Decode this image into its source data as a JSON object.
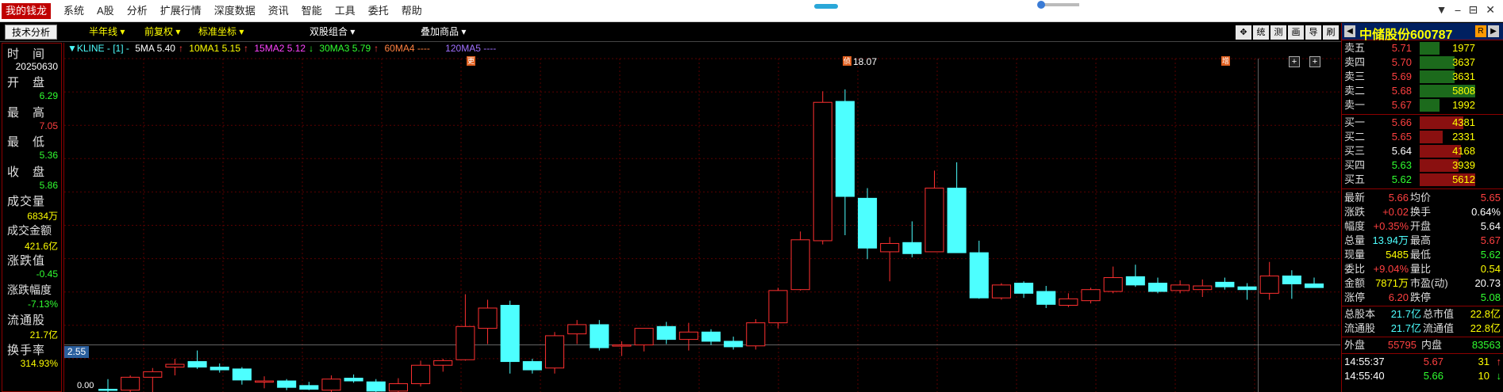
{
  "app": {
    "logo": "我的钱龙"
  },
  "menu": [
    "系统",
    "A股",
    "分析",
    "扩展行情",
    "深度数据",
    "资讯",
    "智能",
    "工具",
    "委托",
    "帮助"
  ],
  "window_buttons": [
    "▼",
    "⎯",
    "⊟",
    "✕"
  ],
  "toolbar": {
    "tab": "技术分析",
    "period": "半年线 ▾",
    "adjust": "前复权 ▾",
    "coord": "标准坐标 ▾",
    "dual": "双股组合 ▾",
    "overlay": "叠加商品 ▾",
    "icons": [
      "✥",
      "统",
      "测",
      "画",
      "导",
      "刷"
    ]
  },
  "left_panel": {
    "time_label": "时　间",
    "date": "20250630",
    "open_label": "开　盘",
    "open": "6.29",
    "high_label": "最　高",
    "high": "7.05",
    "low_label": "最　低",
    "low": "5.36",
    "close_label": "收　盘",
    "close": "5.86",
    "vol_label": "成交量",
    "vol": "6834万",
    "amt_label": "成交金额",
    "amt": "421.6亿",
    "chg_label": "涨跌值",
    "chg": "-0.45",
    "chgpct_label": "涨跌幅度",
    "chgpct": "-7.13%",
    "float_label": "流通股",
    "float": "21.7亿",
    "turnover_label": "换手率",
    "turnover": "314.93%"
  },
  "legend": {
    "kline": "▼KLINE - [1] -",
    "ma5": "5MA 5.40",
    "ma10": "10MA1 5.15",
    "ma15": "15MA2 5.12",
    "ma30": "30MA3 5.79",
    "ma60": "60MA4 ----",
    "ma120": "120MA5 ----"
  },
  "chart_data": {
    "type": "candlestick",
    "title": "",
    "ylabel": "",
    "ylim": [
      0.0,
      18.07
    ],
    "max_label": "18.07",
    "cursor_price": "2.55",
    "bottom_label": "0.00",
    "up_color": "#ff3030",
    "down_color": "#4dffff",
    "flags": [
      "更",
      "侦",
      "增"
    ],
    "candles": [
      {
        "o": 0.15,
        "h": 0.7,
        "l": 0.0,
        "c": 0.1
      },
      {
        "o": 0.1,
        "h": 0.9,
        "l": 0.0,
        "c": 0.8
      },
      {
        "o": 0.8,
        "h": 1.3,
        "l": 0.0,
        "c": 1.1
      },
      {
        "o": 1.35,
        "h": 1.8,
        "l": 0.9,
        "c": 1.5
      },
      {
        "o": 1.65,
        "h": 2.25,
        "l": 1.25,
        "c": 1.35
      },
      {
        "o": 1.35,
        "h": 1.55,
        "l": 1.05,
        "c": 1.2
      },
      {
        "o": 1.25,
        "h": 1.35,
        "l": 0.4,
        "c": 0.65
      },
      {
        "o": 0.55,
        "h": 0.85,
        "l": 0.2,
        "c": 0.6
      },
      {
        "o": 0.6,
        "h": 0.7,
        "l": 0.1,
        "c": 0.25
      },
      {
        "o": 0.35,
        "h": 0.55,
        "l": 0.1,
        "c": 0.15
      },
      {
        "o": 0.1,
        "h": 0.9,
        "l": 0.0,
        "c": 0.7
      },
      {
        "o": 0.75,
        "h": 0.95,
        "l": 0.5,
        "c": 0.6
      },
      {
        "o": 0.55,
        "h": 0.7,
        "l": 0.0,
        "c": 0.05
      },
      {
        "o": 0.05,
        "h": 0.75,
        "l": 0.0,
        "c": 0.45
      },
      {
        "o": 0.45,
        "h": 1.7,
        "l": 0.3,
        "c": 1.45
      },
      {
        "o": 1.45,
        "h": 1.8,
        "l": 1.1,
        "c": 1.7
      },
      {
        "o": 1.75,
        "h": 5.3,
        "l": 1.7,
        "c": 3.55
      },
      {
        "o": 3.45,
        "h": 5.0,
        "l": 2.6,
        "c": 4.55
      },
      {
        "o": 4.7,
        "h": 4.95,
        "l": 1.0,
        "c": 1.65
      },
      {
        "o": 1.65,
        "h": 1.8,
        "l": 1.0,
        "c": 1.2
      },
      {
        "o": 1.3,
        "h": 3.25,
        "l": 1.0,
        "c": 3.05
      },
      {
        "o": 3.15,
        "h": 3.9,
        "l": 2.6,
        "c": 3.65
      },
      {
        "o": 3.65,
        "h": 3.9,
        "l": 2.25,
        "c": 2.4
      },
      {
        "o": 2.5,
        "h": 2.75,
        "l": 1.95,
        "c": 2.55
      },
      {
        "o": 2.55,
        "h": 3.25,
        "l": 2.2,
        "c": 3.45
      },
      {
        "o": 3.55,
        "h": 3.8,
        "l": 2.6,
        "c": 2.85
      },
      {
        "o": 2.85,
        "h": 3.75,
        "l": 2.25,
        "c": 3.25
      },
      {
        "o": 3.25,
        "h": 3.4,
        "l": 2.55,
        "c": 2.75
      },
      {
        "o": 2.75,
        "h": 3.0,
        "l": 2.3,
        "c": 2.45
      },
      {
        "o": 2.5,
        "h": 3.95,
        "l": 2.3,
        "c": 3.75
      },
      {
        "o": 3.75,
        "h": 5.65,
        "l": 3.45,
        "c": 5.5
      },
      {
        "o": 5.55,
        "h": 8.7,
        "l": 5.5,
        "c": 8.25
      },
      {
        "o": 8.2,
        "h": 16.3,
        "l": 8.0,
        "c": 15.7
      },
      {
        "o": 15.75,
        "h": 16.4,
        "l": 8.5,
        "c": 10.6
      },
      {
        "o": 10.5,
        "h": 11.05,
        "l": 7.2,
        "c": 7.8
      },
      {
        "o": 7.6,
        "h": 8.4,
        "l": 6.0,
        "c": 8.05
      },
      {
        "o": 8.1,
        "h": 9.25,
        "l": 7.3,
        "c": 7.5
      },
      {
        "o": 7.6,
        "h": 12.0,
        "l": 7.6,
        "c": 11.05
      },
      {
        "o": 11.05,
        "h": 12.45,
        "l": 7.9,
        "c": 7.55
      },
      {
        "o": 7.55,
        "h": 8.2,
        "l": 5.05,
        "c": 5.1
      },
      {
        "o": 5.1,
        "h": 5.9,
        "l": 5.0,
        "c": 5.8
      },
      {
        "o": 5.9,
        "h": 6.0,
        "l": 5.1,
        "c": 5.35
      },
      {
        "o": 5.45,
        "h": 5.75,
        "l": 4.55,
        "c": 4.75
      },
      {
        "o": 4.7,
        "h": 5.35,
        "l": 4.6,
        "c": 5.05
      },
      {
        "o": 4.95,
        "h": 5.65,
        "l": 4.8,
        "c": 5.55
      },
      {
        "o": 5.45,
        "h": 6.8,
        "l": 5.35,
        "c": 6.2
      },
      {
        "o": 6.25,
        "h": 6.9,
        "l": 5.7,
        "c": 5.8
      },
      {
        "o": 5.9,
        "h": 6.2,
        "l": 5.35,
        "c": 5.45
      },
      {
        "o": 5.5,
        "h": 6.05,
        "l": 5.35,
        "c": 5.8
      },
      {
        "o": 5.55,
        "h": 6.1,
        "l": 5.15,
        "c": 5.75
      },
      {
        "o": 5.95,
        "h": 6.2,
        "l": 5.55,
        "c": 5.7
      },
      {
        "o": 5.7,
        "h": 5.9,
        "l": 5.0,
        "c": 5.55
      },
      {
        "o": 5.35,
        "h": 7.05,
        "l": 5.0,
        "c": 6.29
      },
      {
        "o": 6.29,
        "h": 6.6,
        "l": 5.05,
        "c": 5.86
      },
      {
        "o": 5.86,
        "h": 6.2,
        "l": 5.7,
        "c": 5.66
      }
    ]
  },
  "right_panel": {
    "title": "中储股份600787",
    "btn_left": "◀",
    "btn_r": "R",
    "btn_right": "▶",
    "asks": [
      {
        "label": "卖五",
        "price": "5.71",
        "vol": "1977",
        "bar": 0.35
      },
      {
        "label": "卖四",
        "price": "5.70",
        "vol": "3637",
        "bar": 0.63
      },
      {
        "label": "卖三",
        "price": "5.69",
        "vol": "3631",
        "bar": 0.63
      },
      {
        "label": "卖二",
        "price": "5.68",
        "vol": "5808",
        "bar": 1.0
      },
      {
        "label": "卖一",
        "price": "5.67",
        "vol": "1992",
        "bar": 0.35
      }
    ],
    "bids": [
      {
        "label": "买一",
        "price": "5.66",
        "vol": "4381",
        "bar": 0.78
      },
      {
        "label": "买二",
        "price": "5.65",
        "vol": "2331",
        "bar": 0.42
      },
      {
        "label": "买三",
        "price": "5.64",
        "vol": "4168",
        "bar": 0.74
      },
      {
        "label": "买四",
        "price": "5.63",
        "vol": "3939",
        "bar": 0.7
      },
      {
        "label": "买五",
        "price": "5.62",
        "vol": "5612",
        "bar": 1.0
      }
    ],
    "quote": [
      {
        "l1": "最新",
        "v1": "5.66",
        "c1": "red",
        "l2": "均价",
        "v2": "5.65",
        "c2": "red"
      },
      {
        "l1": "涨跌",
        "v1": "+0.02",
        "c1": "red",
        "l2": "换手",
        "v2": "0.64%",
        "c2": "wht"
      },
      {
        "l1": "幅度",
        "v1": "+0.35%",
        "c1": "red",
        "l2": "开盘",
        "v2": "5.64",
        "c2": "wht"
      },
      {
        "l1": "总量",
        "v1": "13.94万",
        "c1": "cyan",
        "l2": "最高",
        "v2": "5.67",
        "c2": "red"
      },
      {
        "l1": "现量",
        "v1": "5485",
        "c1": "yel",
        "l2": "最低",
        "v2": "5.62",
        "c2": "grn"
      },
      {
        "l1": "委比",
        "v1": "+9.04%",
        "c1": "red",
        "l2": "量比",
        "v2": "0.54",
        "c2": "yel"
      },
      {
        "l1": "金额",
        "v1": "7871万",
        "c1": "yel",
        "l2": "市盈(动)",
        "v2": "20.73",
        "c2": "wht"
      },
      {
        "l1": "涨停",
        "v1": "6.20",
        "c1": "red",
        "l2": "跌停",
        "v2": "5.08",
        "c2": "grn"
      }
    ],
    "capital": [
      {
        "l1": "总股本",
        "v1": "21.7亿",
        "l2": "总市值",
        "v2": "22.8亿"
      },
      {
        "l1": "流通股",
        "v1": "21.7亿",
        "l2": "流通值",
        "v2": "22.8亿"
      }
    ],
    "outer_label": "外盘",
    "outer": "55795",
    "inner_label": "内盘",
    "inner": "83563",
    "ticks": [
      {
        "time": "14:55:37",
        "price": "5.67",
        "vol": "31",
        "arrow": "↑",
        "color": "red"
      },
      {
        "time": "14:55:40",
        "price": "5.66",
        "vol": "10",
        "arrow": "↓",
        "color": "grn"
      }
    ]
  }
}
